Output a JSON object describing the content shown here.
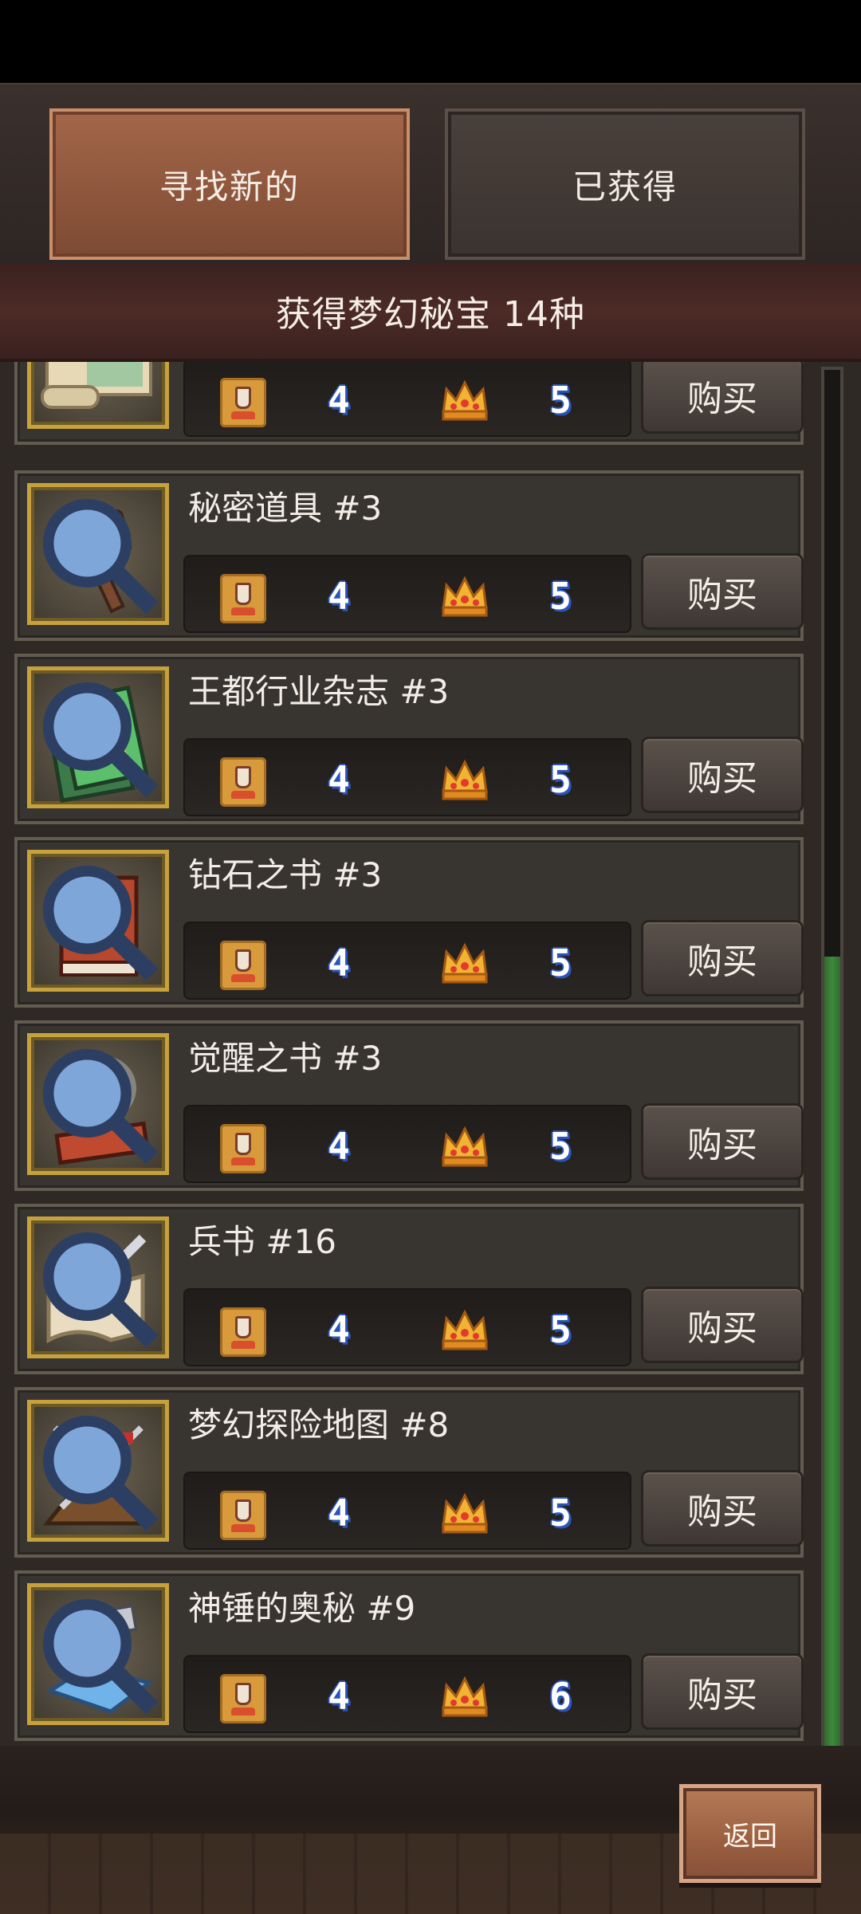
{
  "tabs": {
    "find_new": "寻找新的",
    "obtained": "已获得"
  },
  "banner": {
    "text": "获得梦幻秘宝 14种"
  },
  "buy_label": "购买",
  "items": [
    {
      "name": "",
      "level": "4",
      "rarity": "5",
      "icon": "scroll-map-icon"
    },
    {
      "name": "秘密道具 #3",
      "level": "4",
      "rarity": "5",
      "icon": "mystery-hammer-icon"
    },
    {
      "name": "王都行业杂志 #3",
      "level": "4",
      "rarity": "5",
      "icon": "magazine-book-icon"
    },
    {
      "name": "钻石之书 #3",
      "level": "4",
      "rarity": "5",
      "icon": "diamond-book-icon"
    },
    {
      "name": "觉醒之书 #3",
      "level": "4",
      "rarity": "5",
      "icon": "awakening-book-icon"
    },
    {
      "name": "兵书 #16",
      "level": "4",
      "rarity": "5",
      "icon": "sword-scroll-icon"
    },
    {
      "name": "梦幻探险地图 #8",
      "level": "4",
      "rarity": "5",
      "icon": "tent-spears-icon"
    },
    {
      "name": "神锤的奥秘 #9",
      "level": "4",
      "rarity": "6",
      "icon": "anvil-hammer-icon"
    }
  ],
  "back": {
    "label": "返回"
  },
  "scroll_position": 0.43,
  "colors": {
    "active_tab": "#9a5f40",
    "inactive_tab": "#3b332f",
    "frame_gold": "#c7a23c",
    "number_blue": "#2a55b8",
    "scroll_green": "#3e8a3b"
  }
}
